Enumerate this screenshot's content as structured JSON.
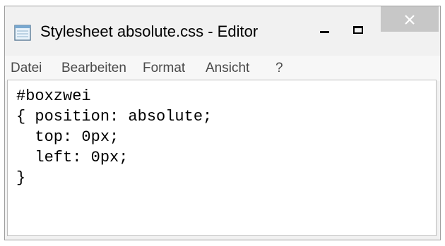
{
  "window": {
    "title": "Stylesheet absolute.css - Editor",
    "app_icon": "notepad-icon",
    "controls": {
      "minimize": "minimize-icon",
      "maximize": "maximize-icon",
      "close": "close-icon"
    }
  },
  "menu": {
    "items": [
      "Datei",
      "Bearbeiten",
      "Format",
      "Ansicht",
      "?"
    ]
  },
  "editor": {
    "lines": [
      "#boxzwei",
      "{ position: absolute;",
      "  top: 0px;",
      "  left: 0px;",
      "}"
    ]
  },
  "colors": {
    "close_button": "#c7c7c7",
    "menu_text": "#4a4a4a",
    "window_bg": "#f1f1f1"
  }
}
